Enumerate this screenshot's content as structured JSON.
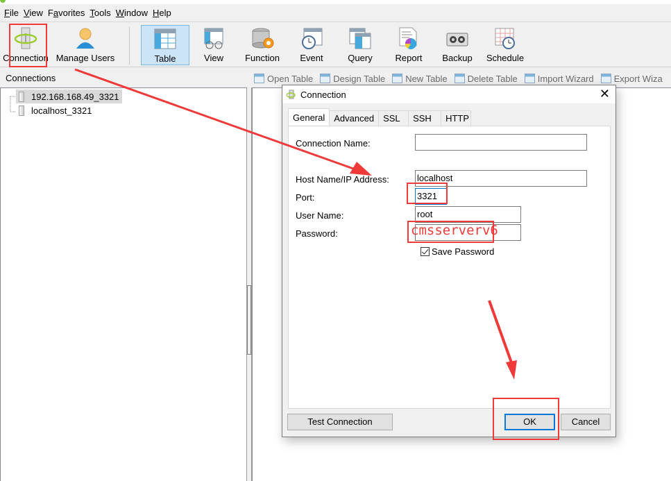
{
  "menu": [
    "File",
    "View",
    "Favorites",
    "Tools",
    "Window",
    "Help"
  ],
  "menu_mnemonics": [
    "F",
    "V",
    "a",
    "T",
    "W",
    "H"
  ],
  "toolbar": {
    "connection": "Connection",
    "manage_users": "Manage Users",
    "table": "Table",
    "view": "View",
    "function": "Function",
    "event": "Event",
    "query": "Query",
    "report": "Report",
    "backup": "Backup",
    "schedule": "Schedule",
    "active": "Table"
  },
  "connections_panel": {
    "title": "Connections",
    "items": [
      "192.168.168.49_3321",
      "localhost_3321"
    ],
    "selected": "192.168.168.49_3321"
  },
  "object_toolbar": [
    "Open Table",
    "Design Table",
    "New Table",
    "Delete Table",
    "Import Wizard",
    "Export Wiza"
  ],
  "dialog": {
    "title": "Connection",
    "tabs": [
      "General",
      "Advanced",
      "SSL",
      "SSH",
      "HTTP"
    ],
    "active_tab": "General",
    "fields": {
      "connection_name": {
        "label": "Connection Name:",
        "value": ""
      },
      "host": {
        "label": "Host Name/IP Address:",
        "value": "localhost"
      },
      "port": {
        "label": "Port:",
        "value": "3321"
      },
      "user": {
        "label": "User Name:",
        "value": "root"
      },
      "password": {
        "label": "Password:",
        "value": ""
      }
    },
    "save_password": {
      "label": "Save Password",
      "checked": true
    },
    "buttons": {
      "test": "Test Connection",
      "ok": "OK",
      "cancel": "Cancel"
    }
  },
  "annotations": {
    "password_hint": "cmsserverv6",
    "color": "#f03a3a"
  }
}
